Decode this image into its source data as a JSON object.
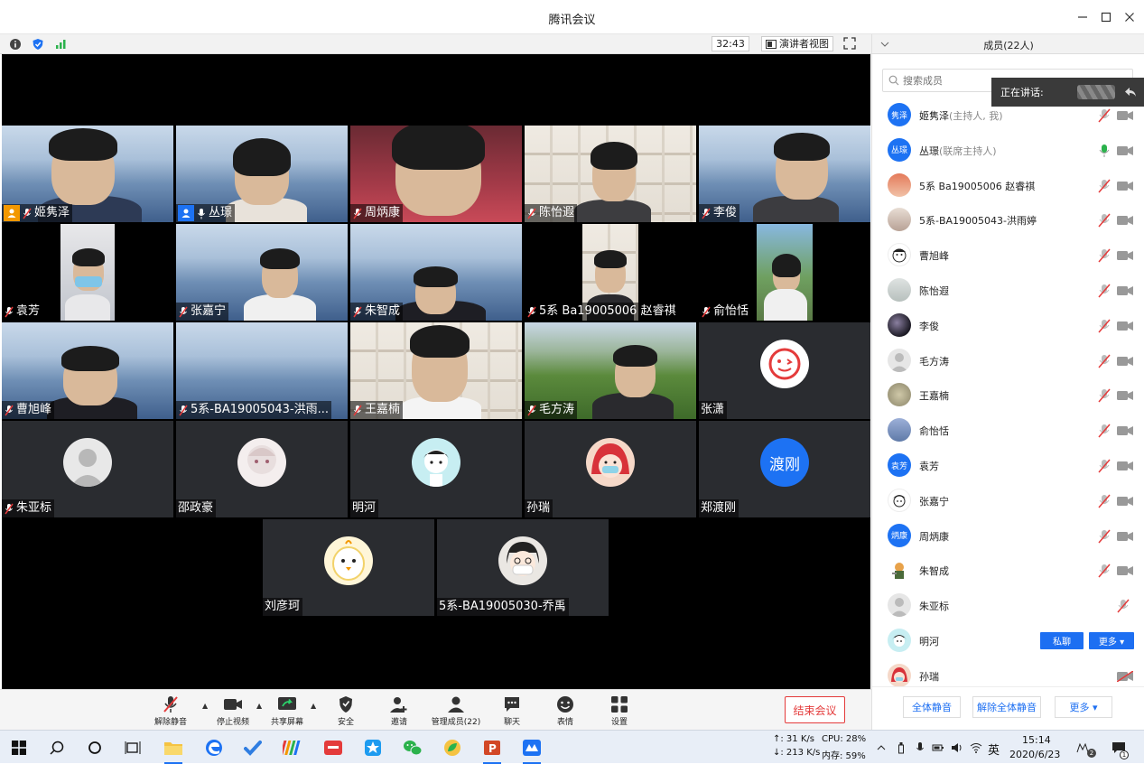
{
  "window": {
    "title": "腾讯会议"
  },
  "infobar": {
    "timer": "32:43",
    "view_label": "演讲者视图"
  },
  "tiles": [
    {
      "name": "姬隽泽"
    },
    {
      "name": "丛璟"
    },
    {
      "name": "周炳康"
    },
    {
      "name": "陈怡遐"
    },
    {
      "name": "李俊"
    },
    {
      "name": "袁芳"
    },
    {
      "name": "张嘉宁"
    },
    {
      "name": "朱智成"
    },
    {
      "name": "5系 Ba19005006 赵睿祺"
    },
    {
      "name": "俞怡恬"
    },
    {
      "name": "曹旭峰"
    },
    {
      "name": "5系-BA19005043-洪雨..."
    },
    {
      "name": "王嘉楠"
    },
    {
      "name": "毛方涛"
    },
    {
      "name": "张潇"
    },
    {
      "name": "朱亚标"
    },
    {
      "name": "邵政豪"
    },
    {
      "name": "明河"
    },
    {
      "name": "孙瑞"
    },
    {
      "name": "郑渡刚",
      "avatar_text": "渡刚"
    },
    {
      "name": "刘彦珂"
    },
    {
      "name": "5系-BA19005030-乔禹"
    }
  ],
  "toolbar": {
    "unmute": "解除静音",
    "stop_video": "停止视频",
    "share_screen": "共享屏幕",
    "security": "安全",
    "invite": "邀请",
    "manage_members": "管理成员(22)",
    "chat": "聊天",
    "reactions": "表情",
    "settings": "设置",
    "end_meeting": "结束会议"
  },
  "sidebar": {
    "title": "成员(22人)",
    "search_placeholder": "搜索成员",
    "speaking_label": "正在讲话:",
    "members": [
      {
        "name": "姬隽泽",
        "role": "(主持人, 我)",
        "avatar_text": "隽泽"
      },
      {
        "name": "丛璟",
        "role": "(联席主持人)",
        "avatar_text": "丛璟"
      },
      {
        "name": "5系 Ba19005006 赵睿祺",
        "role": ""
      },
      {
        "name": "5系-BA19005043-洪雨婷",
        "role": ""
      },
      {
        "name": "曹旭峰",
        "role": ""
      },
      {
        "name": "陈怡遐",
        "role": ""
      },
      {
        "name": "李俊",
        "role": ""
      },
      {
        "name": "毛方涛",
        "role": ""
      },
      {
        "name": "王嘉楠",
        "role": ""
      },
      {
        "name": "俞怡恬",
        "role": ""
      },
      {
        "name": "袁芳",
        "role": "",
        "avatar_text": "袁芳"
      },
      {
        "name": "张嘉宁",
        "role": ""
      },
      {
        "name": "周炳康",
        "role": "",
        "avatar_text": "炳康"
      },
      {
        "name": "朱智成",
        "role": ""
      },
      {
        "name": "朱亚标",
        "role": ""
      },
      {
        "name": "明河",
        "role": ""
      },
      {
        "name": "孙瑞",
        "role": ""
      }
    ],
    "private_chat": "私聊",
    "more_row": "更多 ▾",
    "mute_all": "全体静音",
    "unmute_all": "解除全体静音",
    "more": "更多 ▾"
  },
  "taskbar": {
    "net_up": "↑: 31 K/s",
    "net_down": "↓: 213 K/s",
    "cpu": "CPU: 28%",
    "mem": "内存: 59%",
    "ime": "英",
    "time": "15:14",
    "date": "2020/6/23",
    "badge_count": "2",
    "notif_count": "1"
  },
  "colors": {
    "accent": "#1d6ff2",
    "end": "#e43b3b",
    "host": "#f39800"
  }
}
